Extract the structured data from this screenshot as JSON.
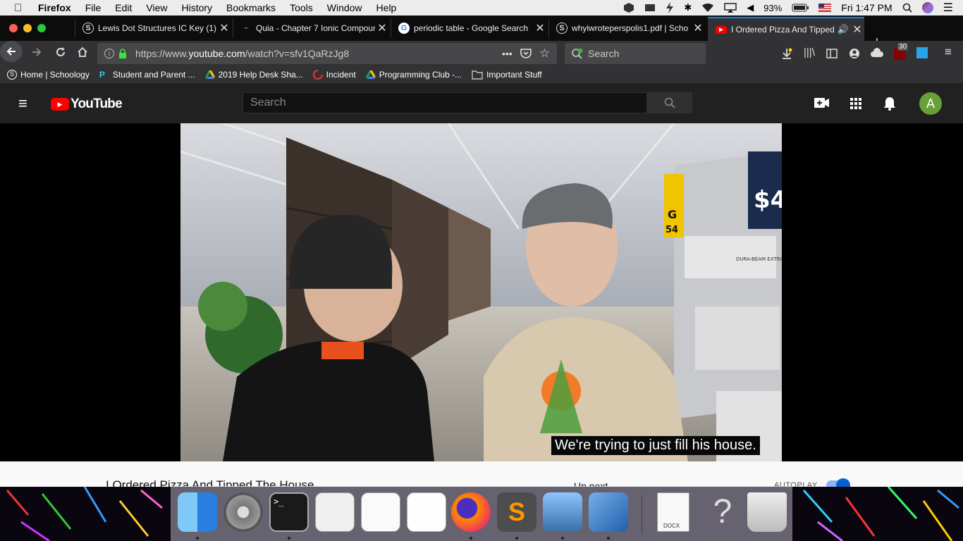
{
  "menubar": {
    "items": [
      "Firefox",
      "File",
      "Edit",
      "View",
      "History",
      "Bookmarks",
      "Tools",
      "Window",
      "Help"
    ],
    "battery": "93%",
    "clock": "Fri 1:47 PM"
  },
  "tabs": [
    {
      "title": "Lewis Dot Structures IC Key (1)",
      "icon": "schoology-icon",
      "active": false
    },
    {
      "title": "Quia - Chapter 7 Ionic Compour",
      "icon": "quia-icon",
      "active": false
    },
    {
      "title": "periodic table - Google Search",
      "icon": "google-icon",
      "active": false
    },
    {
      "title": "whyiwroteperspolis1.pdf | Scho",
      "icon": "schoology-icon",
      "active": false
    },
    {
      "title": "I Ordered Pizza And Tipped",
      "icon": "youtube-icon",
      "active": true
    }
  ],
  "navbar": {
    "url_prefix": "https://www.",
    "url_domain": "youtube.com",
    "url_path": "/watch?v=sfv1QaRzJg8",
    "search_placeholder": "Search",
    "badge_count": "30"
  },
  "bookmarks": [
    {
      "label": "Home | Schoology",
      "icon": "schoology-icon"
    },
    {
      "label": "Student and Parent ...",
      "icon": "p-icon"
    },
    {
      "label": "2019 Help Desk Sha...",
      "icon": "drive-icon"
    },
    {
      "label": "Incident",
      "icon": "incident-icon"
    },
    {
      "label": "Programming Club -...",
      "icon": "drive-icon"
    },
    {
      "label": "Important Stuff",
      "icon": "folder-icon"
    }
  ],
  "youtube": {
    "logo_text": "YouTube",
    "search_placeholder": "Search",
    "avatar_letter": "A"
  },
  "video": {
    "caption": "We're trying to just fill his house.",
    "title": "I Ordered Pizza And Tipped The House",
    "up_next": "Up next",
    "autoplay_label": "AUTOPLAY",
    "autoplay_on": true,
    "sign_aisle": "G",
    "sign_number": "54",
    "price_sign": "$4",
    "box_label": "DURA-BEAM EXTRA"
  },
  "dock": {
    "apps": [
      "Finder",
      "System Preferences",
      "Terminal",
      "Script Editor",
      "TextEdit",
      "Notes",
      "Firefox",
      "Sublime Text",
      "Preview",
      "VirtualBox",
      "DOCX",
      "Unknown",
      "Trash"
    ],
    "docx_label": "DOCX"
  }
}
